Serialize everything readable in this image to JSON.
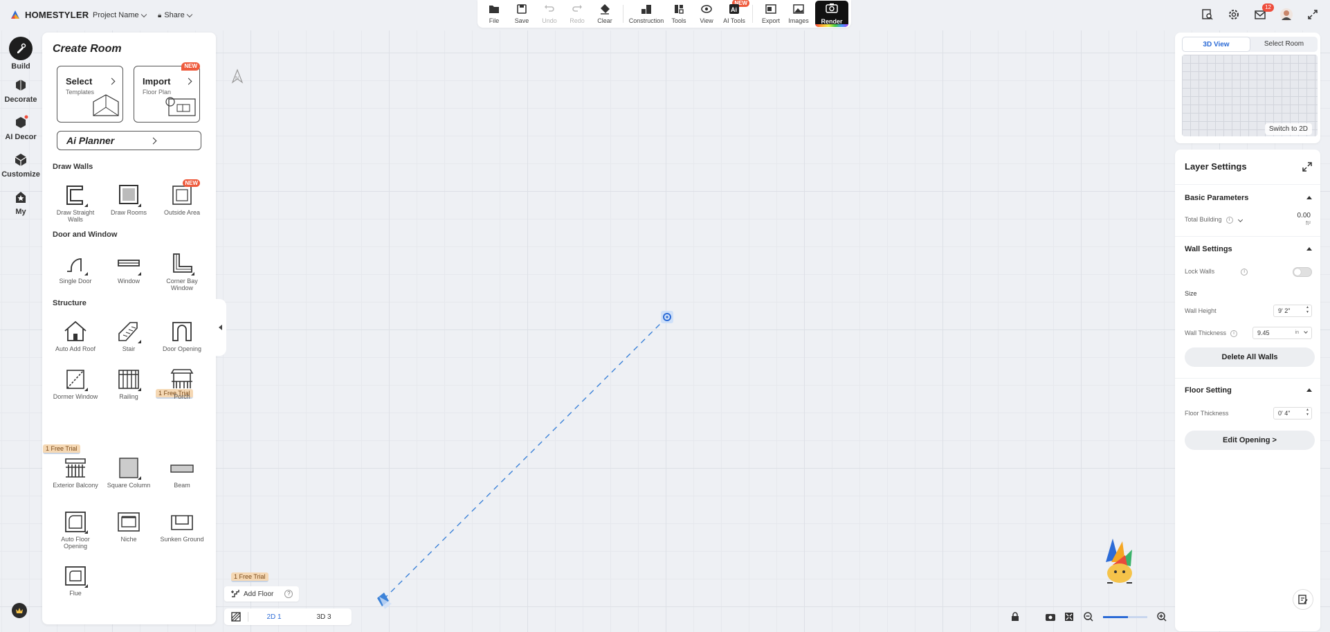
{
  "app": {
    "brand": "HOMESTYLER",
    "project_name": "Project Name",
    "share": "Share",
    "notifications": "12"
  },
  "toolbar": [
    {
      "id": "file",
      "label": "File"
    },
    {
      "id": "save",
      "label": "Save"
    },
    {
      "id": "undo",
      "label": "Undo",
      "disabled": true
    },
    {
      "id": "redo",
      "label": "Redo",
      "disabled": true
    },
    {
      "id": "clear",
      "label": "Clear"
    },
    {
      "id": "construction",
      "label": "Construction"
    },
    {
      "id": "tools",
      "label": "Tools"
    },
    {
      "id": "view",
      "label": "View"
    },
    {
      "id": "ai-tools",
      "label": "AI Tools",
      "badge": "NEW"
    },
    {
      "id": "export",
      "label": "Export"
    },
    {
      "id": "images",
      "label": "Images"
    },
    {
      "id": "render",
      "label": "Render"
    }
  ],
  "leftnav": [
    {
      "label": "Build",
      "icon": "build-icon",
      "active": true
    },
    {
      "label": "Decorate",
      "icon": "decorate-icon"
    },
    {
      "label": "AI Decor",
      "icon": "ai-decor-icon"
    },
    {
      "label": "Customize",
      "icon": "customize-icon"
    },
    {
      "label": "My",
      "icon": "my-icon"
    }
  ],
  "panel": {
    "title": "Create Room",
    "select": {
      "title": "Select",
      "subtitle": "Templates"
    },
    "import": {
      "title": "Import",
      "subtitle": "Floor Plan",
      "badge": "NEW"
    },
    "ai_planner": "Ai Planner",
    "sections": {
      "walls": "Draw Walls",
      "door_window": "Door and Window",
      "structure": "Structure"
    },
    "walls": [
      "Draw Straight Walls",
      "Draw Rooms",
      "Outside Area"
    ],
    "walls_new_badge": "NEW",
    "doors": [
      "Single Door",
      "Window",
      "Corner Bay Window"
    ],
    "structure": [
      "Auto Add Roof",
      "Stair",
      "Door Opening",
      "Dormer Window",
      "Railing",
      "Porch",
      "Exterior Balcony",
      "Square Column",
      "Beam",
      "Auto Floor Opening",
      "Niche",
      "Sunken Ground",
      "Flue"
    ],
    "trial": "1 Free Trial"
  },
  "right": {
    "tab_3d": "3D View",
    "tab_select": "Select Room",
    "switch_2d": "Switch to 2D",
    "layer_title": "Layer Settings",
    "basic_params": "Basic Parameters",
    "total_building": "Total Building",
    "total_value": "0.00",
    "total_unit": "ft²",
    "wall_settings": "Wall Settings",
    "lock_walls": "Lock Walls",
    "size": "Size",
    "wall_height": "Wall Height",
    "wall_height_value": "9' 2\"",
    "wall_thickness": "Wall Thickness",
    "wall_thickness_value": "9.45",
    "wall_thickness_unit": "in",
    "delete_walls": "Delete All Walls",
    "floor_setting": "Floor Setting",
    "floor_thickness": "Floor Thickness",
    "floor_thickness_value": "0' 4\"",
    "edit_opening": "Edit Opening >"
  },
  "bottom": {
    "trial": "1 Free Trial",
    "add_floor": "Add Floor",
    "help": "?",
    "view_2d": "2D 1",
    "view_3d": "3D 3"
  },
  "colors": {
    "accent": "#2c6bd6",
    "new_badge": "#ee5a3c",
    "trial_bg": "#f5d8b4"
  }
}
